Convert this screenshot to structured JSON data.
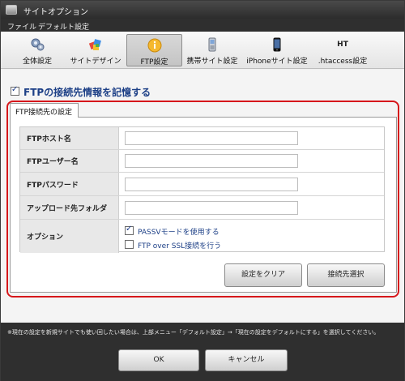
{
  "window": {
    "title": "サイトオプション"
  },
  "menu": {
    "items": [
      "ファイル",
      "デフォルト設定"
    ]
  },
  "toolbar": {
    "items": [
      {
        "label": "全体設定",
        "icon": "gears-icon"
      },
      {
        "label": "サイトデザイン",
        "icon": "palette-icon"
      },
      {
        "label": "FTP設定",
        "icon": "info-icon",
        "active": true
      },
      {
        "label": "携帯サイト設定",
        "icon": "mobile-phone-icon"
      },
      {
        "label": "iPhoneサイト設定",
        "icon": "iphone-icon"
      },
      {
        "label": ".htaccess設定",
        "icon": "ht-icon"
      }
    ],
    "ht_text": "HT"
  },
  "ftp": {
    "remember_label": "FTPの接続先情報を記憶する",
    "remember_checked": true,
    "tab_label": "FTP接続先の設定",
    "fields": {
      "host_label": "FTPホスト名",
      "host_value": "",
      "user_label": "FTPユーザー名",
      "user_value": "",
      "password_label": "FTPパスワード",
      "password_value": "",
      "upload_label": "アップロード先フォルダ",
      "upload_value": ""
    },
    "options_label": "オプション",
    "passv_label": "PASSVモードを使用する",
    "passv_checked": true,
    "ssl_label": "FTP over SSL接続を行う",
    "ssl_checked": false,
    "clear_button": "設定をクリア",
    "select_button": "接続先選択"
  },
  "footer": {
    "note": "※現在の設定を新規サイトでも使い回したい場合は、上部メニュー「デフォルト設定」→「現在の設定をデフォルトにする」を選択してください。",
    "ok": "OK",
    "cancel": "キャンセル"
  },
  "colors": {
    "highlight": "#d6171b",
    "accent_text": "#1c3f86"
  }
}
